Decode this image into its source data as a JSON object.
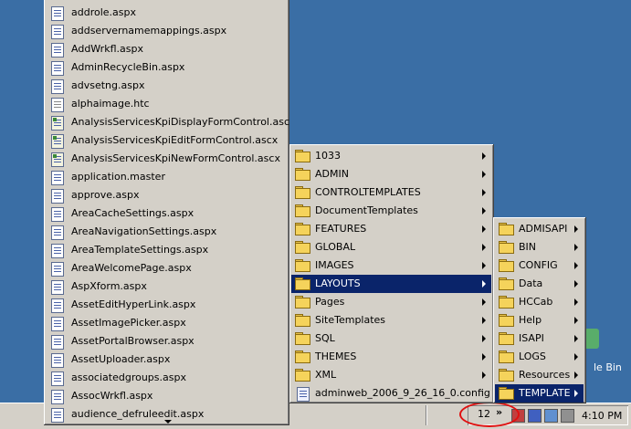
{
  "desktop": {
    "recycle_bin_label": "le Bin"
  },
  "menu_left": {
    "items": [
      {
        "label": "addrole.aspx",
        "icon": "aspx-file-icon"
      },
      {
        "label": "addservernamemappings.aspx",
        "icon": "aspx-file-icon"
      },
      {
        "label": "AddWrkfl.aspx",
        "icon": "aspx-file-icon"
      },
      {
        "label": "AdminRecycleBin.aspx",
        "icon": "aspx-file-icon"
      },
      {
        "label": "advsetng.aspx",
        "icon": "aspx-file-icon"
      },
      {
        "label": "alphaimage.htc",
        "icon": "htc-file-icon"
      },
      {
        "label": "AnalysisServicesKpiDisplayFormControl.ascx",
        "icon": "ascx-file-icon"
      },
      {
        "label": "AnalysisServicesKpiEditFormControl.ascx",
        "icon": "ascx-file-icon"
      },
      {
        "label": "AnalysisServicesKpiNewFormControl.ascx",
        "icon": "ascx-file-icon"
      },
      {
        "label": "application.master",
        "icon": "master-file-icon"
      },
      {
        "label": "approve.aspx",
        "icon": "aspx-file-icon"
      },
      {
        "label": "AreaCacheSettings.aspx",
        "icon": "aspx-file-icon"
      },
      {
        "label": "AreaNavigationSettings.aspx",
        "icon": "aspx-file-icon"
      },
      {
        "label": "AreaTemplateSettings.aspx",
        "icon": "aspx-file-icon"
      },
      {
        "label": "AreaWelcomePage.aspx",
        "icon": "aspx-file-icon"
      },
      {
        "label": "AspXform.aspx",
        "icon": "aspx-file-icon"
      },
      {
        "label": "AssetEditHyperLink.aspx",
        "icon": "aspx-file-icon"
      },
      {
        "label": "AssetImagePicker.aspx",
        "icon": "aspx-file-icon"
      },
      {
        "label": "AssetPortalBrowser.aspx",
        "icon": "aspx-file-icon"
      },
      {
        "label": "AssetUploader.aspx",
        "icon": "aspx-file-icon"
      },
      {
        "label": "associatedgroups.aspx",
        "icon": "aspx-file-icon"
      },
      {
        "label": "AssocWrkfl.aspx",
        "icon": "aspx-file-icon"
      },
      {
        "label": "audience_defruleedit.aspx",
        "icon": "aspx-file-icon"
      }
    ]
  },
  "menu_middle": {
    "items": [
      {
        "label": "1033",
        "submenu": true
      },
      {
        "label": "ADMIN",
        "submenu": true
      },
      {
        "label": "CONTROLTEMPLATES",
        "submenu": true
      },
      {
        "label": "DocumentTemplates",
        "submenu": true
      },
      {
        "label": "FEATURES",
        "submenu": true
      },
      {
        "label": "GLOBAL",
        "submenu": true
      },
      {
        "label": "IMAGES",
        "submenu": true
      },
      {
        "label": "LAYOUTS",
        "submenu": true,
        "selected": true
      },
      {
        "label": "Pages",
        "submenu": true
      },
      {
        "label": "SiteTemplates",
        "submenu": true
      },
      {
        "label": "SQL",
        "submenu": true
      },
      {
        "label": "THEMES",
        "submenu": true
      },
      {
        "label": "XML",
        "submenu": true
      },
      {
        "label": "adminweb_2006_9_26_16_0.config",
        "submenu": false,
        "file": true
      }
    ]
  },
  "menu_right": {
    "items": [
      {
        "label": "ADMISAPI"
      },
      {
        "label": "BIN"
      },
      {
        "label": "CONFIG"
      },
      {
        "label": "Data"
      },
      {
        "label": "HCCab"
      },
      {
        "label": "Help"
      },
      {
        "label": "ISAPI"
      },
      {
        "label": "LOGS"
      },
      {
        "label": "Resources"
      },
      {
        "label": "TEMPLATE",
        "selected": true
      }
    ]
  },
  "taskbar": {
    "tray_count": "12",
    "chevron": "»",
    "clock": "4:10 PM"
  },
  "colors": {
    "desktop": "#3a6ea5",
    "menu_bg": "#d4d0c8",
    "selection": "#0a246a",
    "annotation_ring": "#e01010"
  }
}
